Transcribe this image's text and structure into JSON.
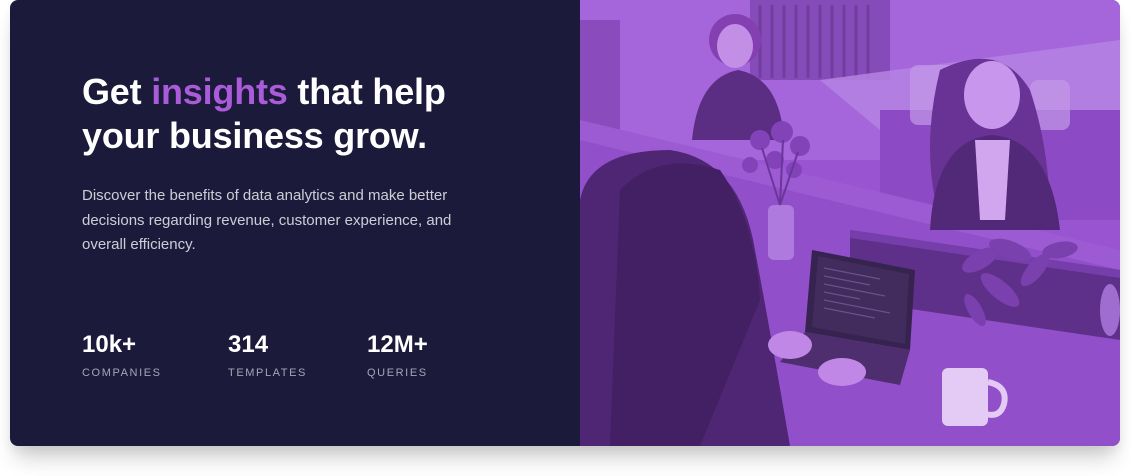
{
  "hero": {
    "headline_before": "Get ",
    "headline_accent": "insights",
    "headline_after": " that help your business grow.",
    "description": "Discover the benefits of data analytics and make better decisions regarding revenue, customer experience, and overall efficiency."
  },
  "stats": [
    {
      "value": "10k+",
      "label": "Companies"
    },
    {
      "value": "314",
      "label": "Templates"
    },
    {
      "value": "12M+",
      "label": "Queries"
    }
  ],
  "image": {
    "subject": "people working at a table with laptops",
    "tint_color": "#aa5cdb"
  },
  "colors": {
    "background": "#1c1a3b",
    "accent": "#a95bd9",
    "text": "#ffffff"
  }
}
